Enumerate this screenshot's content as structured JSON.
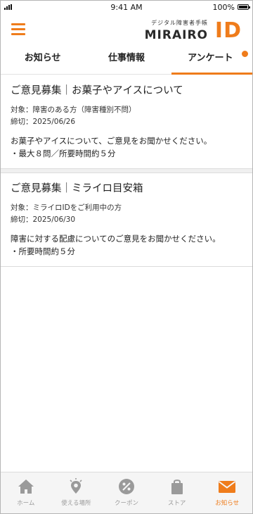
{
  "status_bar": {
    "time": "9:41 AM",
    "battery": "100%"
  },
  "header": {
    "logo_tagline": "デジタル障害者手帳",
    "logo_name": "MIRAIRO",
    "logo_id": "ID"
  },
  "tabs": [
    {
      "label": "お知らせ",
      "active": false
    },
    {
      "label": "仕事情報",
      "active": false
    },
    {
      "label": "アンケート",
      "active": true,
      "badge": true
    }
  ],
  "surveys": [
    {
      "title": "ご意見募集｜お菓子やアイスについて",
      "target_label": "対象：",
      "target": "障害のある方（障害種別不問）",
      "deadline_label": "締切：",
      "deadline": "2025/06/26",
      "description": "お菓子やアイスについて、ご意見をお聞かせください。",
      "detail": "・最大８問／所要時間約５分"
    },
    {
      "title": "ご意見募集｜ミライロ目安箱",
      "target_label": "対象：",
      "target": "ミライロIDをご利用中の方",
      "deadline_label": "締切：",
      "deadline": "2025/06/30",
      "description": "障害に対する配慮についてのご意見をお聞かせください。",
      "detail": "・所要時間約５分"
    }
  ],
  "bottom_nav": [
    {
      "label": "ホーム",
      "icon": "home-icon",
      "active": false
    },
    {
      "label": "使える場所",
      "icon": "map-pin-icon",
      "active": false
    },
    {
      "label": "クーポン",
      "icon": "coupon-icon",
      "active": false
    },
    {
      "label": "ストア",
      "icon": "shopping-bag-icon",
      "active": false
    },
    {
      "label": "お知らせ",
      "icon": "mail-icon",
      "active": true
    }
  ],
  "colors": {
    "accent": "#ef7c1b",
    "inactive": "#9a9a9a"
  }
}
